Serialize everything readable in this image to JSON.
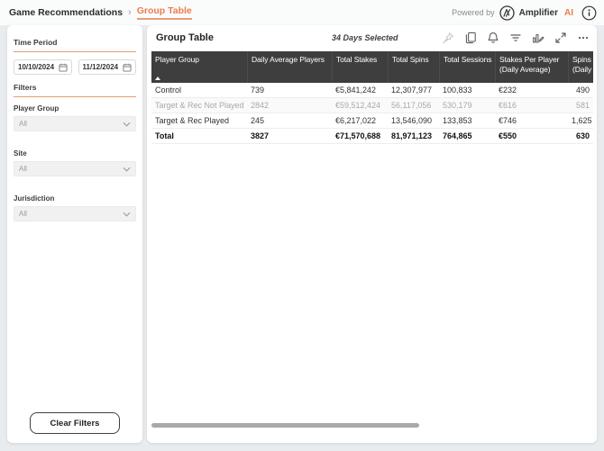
{
  "topbar": {
    "breadcrumb": {
      "root": "Game Recommendations",
      "separator": "›",
      "current": "Group Table"
    },
    "powered_by": "Powered by",
    "brand_name": "Amplifier",
    "brand_suffix": "AI"
  },
  "sidebar": {
    "time_period": {
      "label": "Time Period",
      "start_date": "10/10/2024",
      "end_date": "11/12/2024"
    },
    "filters_label": "Filters",
    "filters": [
      {
        "label": "Player Group",
        "value": "All"
      },
      {
        "label": "Site",
        "value": "All"
      },
      {
        "label": "Jurisdiction",
        "value": "All"
      }
    ],
    "clear_button": "Clear Filters"
  },
  "main": {
    "title": "Group Table",
    "subtitle": "34 Days Selected",
    "toolbar_icons": [
      "pin-icon",
      "copy-icon",
      "alert-icon",
      "filter-icon",
      "edit-chart-icon",
      "focus-mode-icon",
      "more-options-icon"
    ],
    "table": {
      "columns": [
        "Player Group",
        "Daily Average Players",
        "Total Stakes",
        "Total Spins",
        "Total Sessions",
        "Stakes Per Player (Daily Average)",
        "Spins (Daily"
      ],
      "sorted_column": "Player Group",
      "rows": [
        {
          "style": "normal",
          "cells": [
            "Control",
            "739",
            "€5,841,242",
            "12,307,977",
            "100,833",
            "€232",
            "490"
          ]
        },
        {
          "style": "muted",
          "cells": [
            "Target & Rec Not Played",
            "2842",
            "€59,512,424",
            "56,117,056",
            "530,179",
            "€616",
            "581"
          ]
        },
        {
          "style": "normal",
          "cells": [
            "Target & Rec Played",
            "245",
            "€6,217,022",
            "13,546,090",
            "133,853",
            "€746",
            "1,625"
          ]
        },
        {
          "style": "total",
          "cells": [
            "Total",
            "3827",
            "€71,570,688",
            "81,971,123",
            "764,865",
            "€550",
            "630"
          ]
        }
      ]
    }
  },
  "colors": {
    "accent": "#ED7C50",
    "table_header_bg": "#3E3E3E",
    "muted_row_text": "#A8A8A8",
    "scrollbar_thumb": "#A9A9A9"
  }
}
